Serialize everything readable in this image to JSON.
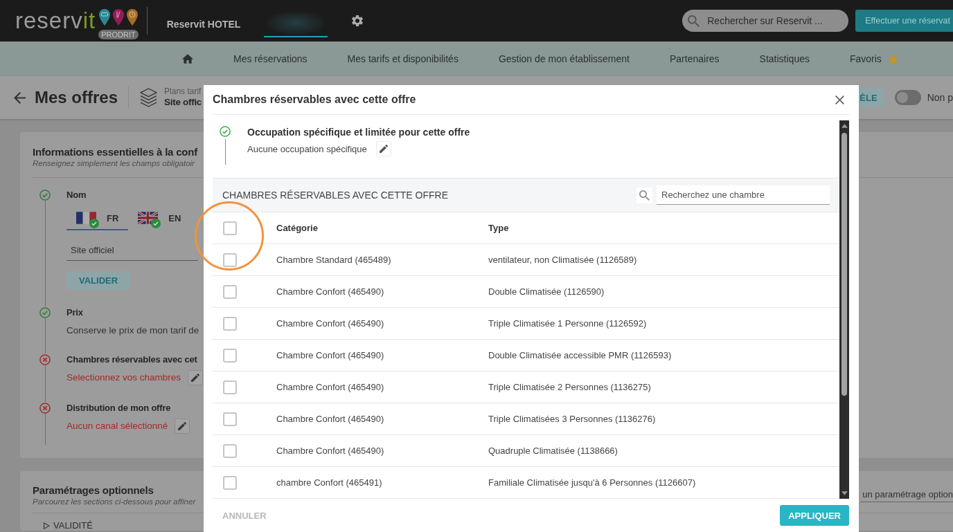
{
  "top_bar": {
    "logo": {
      "text": "reserv",
      "accent": "it",
      "badge": "PRODRIT"
    },
    "tabs": [
      {
        "kind": "text",
        "label": "Reservit HOTEL",
        "selected": false
      },
      {
        "kind": "blurred",
        "selected": true
      }
    ],
    "search": {
      "placeholder": "Rechercher sur Reservit ..."
    },
    "action_button": "Effectuer une réservat"
  },
  "nav": {
    "items": [
      {
        "kind": "home",
        "selected": false
      },
      {
        "kind": "text",
        "label": "Mes réservations",
        "selected": false
      },
      {
        "kind": "text",
        "label": "Mes tarifs et disponibilités",
        "selected": false
      },
      {
        "kind": "text",
        "label": "Gestion de mon établissement",
        "selected": false
      },
      {
        "kind": "text",
        "label": "Partenaires",
        "selected": false
      },
      {
        "kind": "text",
        "label": "Statistiques",
        "selected": false
      },
      {
        "kind": "favorites",
        "label": "Favoris",
        "selected": false
      }
    ]
  },
  "page_header": {
    "title": "Mes offres",
    "breadcrumb_label": "Plans tarif",
    "breadcrumb_value": "Site offic",
    "model_button": "ÈLE",
    "toggle": {
      "on": false,
      "label": "Non p"
    }
  },
  "essentials": {
    "title": "Informations essentielles à la conf",
    "subtitle": "Renseignez simplement les champs obligatoir",
    "steps": [
      {
        "kind": "name",
        "done": true,
        "title": "Nom",
        "languages": [
          {
            "kind": "france",
            "code": "FR",
            "valid": true,
            "selected": true
          },
          {
            "kind": "uk",
            "code": "EN",
            "valid": true,
            "selected": false
          }
        ],
        "value": "Site officiel",
        "button": "VALIDER"
      },
      {
        "kind": "text",
        "done": true,
        "title": "Prix",
        "text": "Conserve le prix de mon tarif de"
      },
      {
        "kind": "edit",
        "done": false,
        "title": "Chambres réservables avec cet",
        "text": "Selectionnez vos chambres"
      },
      {
        "kind": "edit",
        "done": false,
        "title": "Distribution de mon offre",
        "text": "Aucun canal sélectionné"
      }
    ]
  },
  "optional": {
    "title": "Paramétrages optionnels",
    "subtitle": "Parcourez les sections ci-dessous pour affiner",
    "search": {
      "placeholder": "un paramétrage option"
    },
    "sections": [
      {
        "label": "VALIDITÉ",
        "expanded": false
      }
    ]
  },
  "modal": {
    "title": "Chambres réservables avec cette offre",
    "occupation": {
      "done": true,
      "title": "Occupation spécifique et limitée pour cette offre",
      "text": "Aucune occupation spécifique"
    },
    "rooms_panel": {
      "title": "CHAMBRES RÉSERVABLES AVEC CETTE OFFRE",
      "search": {
        "placeholder": "Recherchez une chambre"
      }
    },
    "table": {
      "columns": [
        "Catégorie",
        "Type"
      ],
      "select_all": {
        "checked": false,
        "highlighted": true
      },
      "rows": [
        {
          "checked": false,
          "category": "Chambre Standard (465489)",
          "type": "ventilateur, non Climatisée (1126589)"
        },
        {
          "checked": false,
          "category": "Chambre Confort (465490)",
          "type": "Double Climatisée (1126590)"
        },
        {
          "checked": false,
          "category": "Chambre Confort (465490)",
          "type": "Triple Climatisée 1 Personne (1126592)"
        },
        {
          "checked": false,
          "category": "Chambre Confort (465490)",
          "type": "Double Climatisée accessible PMR (1126593)"
        },
        {
          "checked": false,
          "category": "Chambre Confort (465490)",
          "type": "Triple Climatisée 2 Personnes (1136275)"
        },
        {
          "checked": false,
          "category": "Chambre Confort (465490)",
          "type": "Triple Climatisées 3 Personnes (1136276)"
        },
        {
          "checked": false,
          "category": "Chambre Confort (465490)",
          "type": "Quadruple Climatisée (1138666)"
        },
        {
          "checked": false,
          "category": "chambre Confort (465491)",
          "type": "Familiale Climatisée jusqu'à 6 Personnes (1126607)"
        }
      ]
    },
    "footer": {
      "buttons": [
        {
          "kind": "flat",
          "label": "ANNULER"
        },
        {
          "kind": "primary",
          "label": "APPLIQUER"
        }
      ]
    }
  }
}
